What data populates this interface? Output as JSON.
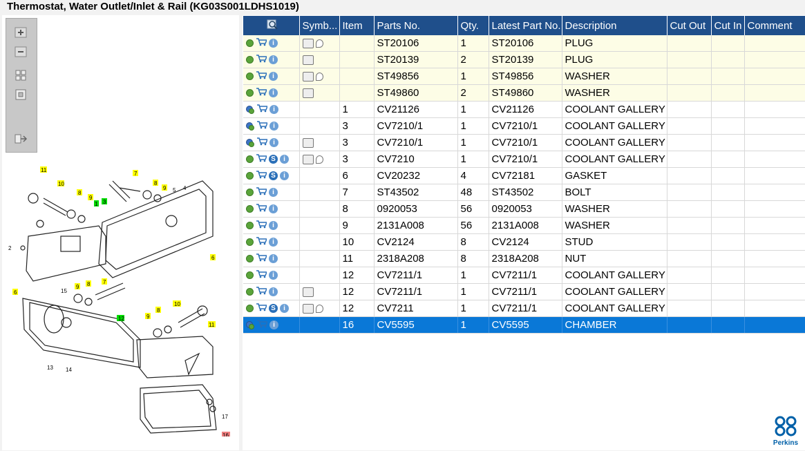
{
  "title": "Thermostat, Water Outlet/Inlet & Rail (KG03S001LDHS1019)",
  "toolbar": {
    "zoom_in": "zoom-in-icon",
    "zoom_out": "zoom-out-icon",
    "fit": "fit-page-icon",
    "actual": "actual-size-icon",
    "export": "export-icon"
  },
  "table": {
    "headers": [
      "",
      "Symb...",
      "Item",
      "Parts No.",
      "Qty.",
      "Latest Part No.",
      "Description",
      "Cut Out",
      "Cut In",
      "Comment"
    ],
    "rows": [
      {
        "kit": true,
        "icons": "g",
        "s": false,
        "sym": "book+bubble",
        "item": "",
        "part": "ST20106",
        "qty": "1",
        "latest": "ST20106",
        "desc": "PLUG"
      },
      {
        "kit": true,
        "icons": "g",
        "s": false,
        "sym": "book",
        "item": "",
        "part": "ST20139",
        "qty": "2",
        "latest": "ST20139",
        "desc": "PLUG"
      },
      {
        "kit": true,
        "icons": "g",
        "s": false,
        "sym": "book+bubble",
        "item": "",
        "part": "ST49856",
        "qty": "1",
        "latest": "ST49856",
        "desc": "WASHER"
      },
      {
        "kit": true,
        "icons": "g",
        "s": false,
        "sym": "book",
        "item": "",
        "part": "ST49860",
        "qty": "2",
        "latest": "ST49860",
        "desc": "WASHER"
      },
      {
        "kit": false,
        "icons": "gb",
        "s": false,
        "sym": "",
        "item": "1",
        "part": "CV21126",
        "qty": "1",
        "latest": "CV21126",
        "desc": "COOLANT GALLERY"
      },
      {
        "kit": false,
        "icons": "gb",
        "s": false,
        "sym": "",
        "item": "3",
        "part": "CV7210/1",
        "qty": "1",
        "latest": "CV7210/1",
        "desc": "COOLANT GALLERY KI"
      },
      {
        "kit": false,
        "icons": "gb",
        "s": false,
        "sym": "book",
        "item": "3",
        "part": "CV7210/1",
        "qty": "1",
        "latest": "CV7210/1",
        "desc": "COOLANT GALLERY KI"
      },
      {
        "kit": false,
        "icons": "g",
        "s": true,
        "sym": "book+bubble",
        "item": "3",
        "part": "CV7210",
        "qty": "1",
        "latest": "CV7210/1",
        "desc": "COOLANT GALLERY"
      },
      {
        "kit": false,
        "icons": "g",
        "s": true,
        "sym": "",
        "item": "6",
        "part": "CV20232",
        "qty": "4",
        "latest": "CV72181",
        "desc": "GASKET"
      },
      {
        "kit": false,
        "icons": "g",
        "s": false,
        "sym": "",
        "item": "7",
        "part": "ST43502",
        "qty": "48",
        "latest": "ST43502",
        "desc": "BOLT"
      },
      {
        "kit": false,
        "icons": "g",
        "s": false,
        "sym": "",
        "item": "8",
        "part": "0920053",
        "qty": "56",
        "latest": "0920053",
        "desc": "WASHER"
      },
      {
        "kit": false,
        "icons": "g",
        "s": false,
        "sym": "",
        "item": "9",
        "part": "2131A008",
        "qty": "56",
        "latest": "2131A008",
        "desc": "WASHER"
      },
      {
        "kit": false,
        "icons": "g",
        "s": false,
        "sym": "",
        "item": "10",
        "part": "CV2124",
        "qty": "8",
        "latest": "CV2124",
        "desc": "STUD"
      },
      {
        "kit": false,
        "icons": "g",
        "s": false,
        "sym": "",
        "item": "11",
        "part": "2318A208",
        "qty": "8",
        "latest": "2318A208",
        "desc": "NUT"
      },
      {
        "kit": false,
        "icons": "g",
        "s": false,
        "sym": "",
        "item": "12",
        "part": "CV7211/1",
        "qty": "1",
        "latest": "CV7211/1",
        "desc": "COOLANT GALLERY KI"
      },
      {
        "kit": false,
        "icons": "g",
        "s": false,
        "sym": "book",
        "item": "12",
        "part": "CV7211/1",
        "qty": "1",
        "latest": "CV7211/1",
        "desc": "COOLANT GALLERY KI"
      },
      {
        "kit": false,
        "icons": "g",
        "s": true,
        "sym": "book+bubble",
        "item": "12",
        "part": "CV7211",
        "qty": "1",
        "latest": "CV7211/1",
        "desc": "COOLANT GALLERY"
      },
      {
        "kit": false,
        "icons": "gb",
        "s": false,
        "sym": "",
        "item": "16",
        "part": "CV5595",
        "qty": "1",
        "latest": "CV5595",
        "desc": "CHAMBER",
        "selected": true
      }
    ]
  },
  "diagram": {
    "callouts": [
      "11",
      "10",
      "8",
      "9",
      "1",
      "3",
      "7",
      "8",
      "9",
      "5",
      "4",
      "2",
      "6",
      "6",
      "15",
      "9",
      "8",
      "7",
      "12",
      "10",
      "9",
      "8",
      "11",
      "13",
      "14",
      "17",
      "16"
    ]
  },
  "brand": {
    "name": "Perkins",
    "color": "#0060a8"
  }
}
